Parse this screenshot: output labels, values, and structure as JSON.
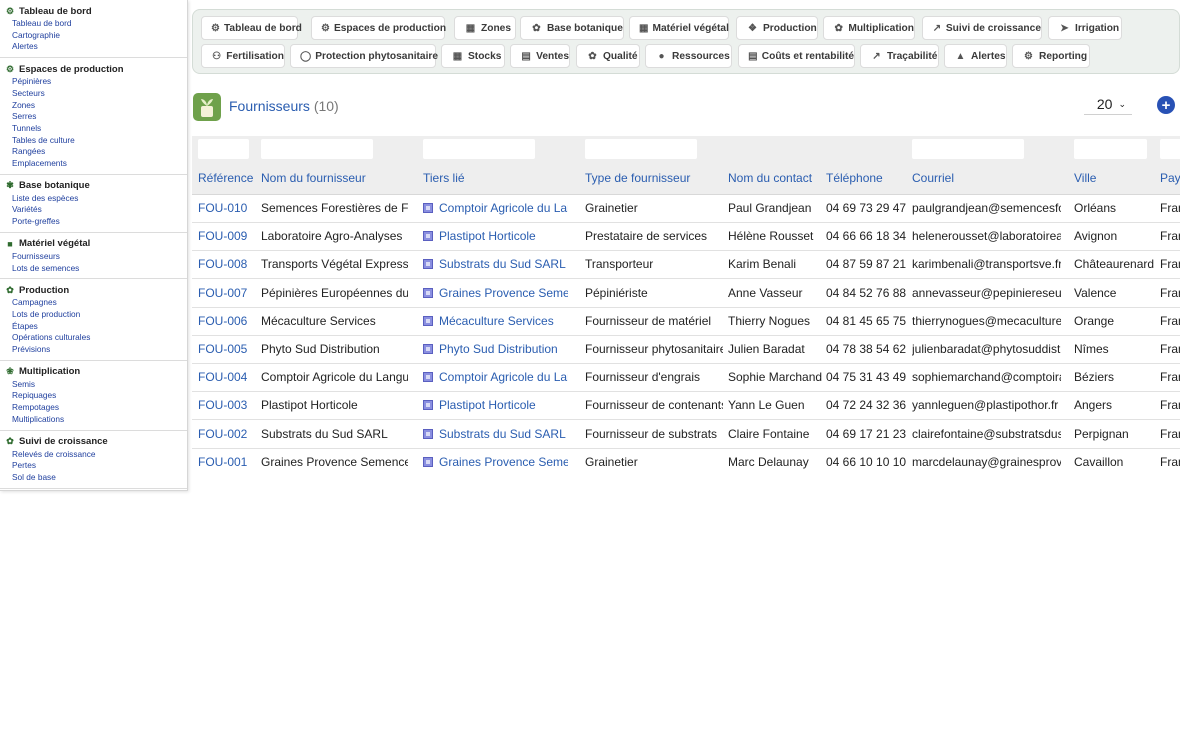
{
  "sidebar": {
    "sections": [
      {
        "title": "Tableau de bord",
        "links": [
          "Tableau de bord",
          "Cartographie",
          "Alertes"
        ]
      },
      {
        "title": "Espaces de production",
        "links": [
          "Pépinières",
          "Secteurs",
          "Zones",
          "Serres",
          "Tunnels",
          "Tables de culture",
          "Rangées",
          "Emplacements"
        ]
      },
      {
        "title": "Base botanique",
        "links": [
          "Liste des espèces",
          "Variétés",
          "Porte-greffes"
        ]
      },
      {
        "title": "Matériel végétal",
        "links": [
          "Fournisseurs",
          "Lots de semences"
        ]
      },
      {
        "title": "Production",
        "links": [
          "Campagnes",
          "Lots de production",
          "Étapes",
          "Opérations culturales",
          "Prévisions"
        ]
      },
      {
        "title": "Multiplication",
        "links": [
          "Semis",
          "Repiquages",
          "Rempotages",
          "Multiplications"
        ]
      },
      {
        "title": "Suivi de croissance",
        "links": [
          "Relevés de croissance",
          "Pertes",
          "Sol de base"
        ]
      }
    ]
  },
  "nav": {
    "row1": [
      "Tableau de bord",
      "Espaces de production",
      "Zones",
      "Base botanique",
      "Matériel végétal",
      "Production",
      "Multiplication",
      "Suivi de croissance",
      "Irrigation"
    ],
    "row2": [
      "Fertilisation",
      "Protection phytosanitaire",
      "Stocks",
      "Ventes",
      "Qualité",
      "Ressources",
      "Coûts et rentabilité",
      "Traçabilité",
      "Alertes",
      "Reporting"
    ]
  },
  "page": {
    "title": "Fournisseurs",
    "count": "(10)",
    "page_size": "20",
    "add_label": "+"
  },
  "table": {
    "columns": [
      "Référence",
      "Nom du fournisseur",
      "Tiers lié",
      "Type de fournisseur",
      "Nom du contact",
      "Téléphone",
      "Courriel",
      "Ville",
      "Pays"
    ],
    "rows": [
      [
        "FOU-010",
        "Semences Forestières de France",
        "Comptoir Agricole du Languedoc",
        "Grainetier",
        "Paul Grandjean",
        "04 69 73 29 47",
        "paulgrandjean@semencesforestieres.fr",
        "Orléans",
        "France"
      ],
      [
        "FOU-009",
        "Laboratoire Agro-Analyses",
        "Plastipot Horticole",
        "Prestataire de services",
        "Hélène Rousset",
        "04 66 66 18 34",
        "helenerousset@laboratoirea.fr",
        "Avignon",
        "France"
      ],
      [
        "FOU-008",
        "Transports Végétal Express",
        "Substrats du Sud SARL",
        "Transporteur",
        "Karim Benali",
        "04 87 59 87 21",
        "karimbenali@transportsve.fr",
        "Châteaurenard",
        "France"
      ],
      [
        "FOU-007",
        "Pépinières Européennes du Sud",
        "Graines Provence Semences",
        "Pépiniériste",
        "Anne Vasseur",
        "04 84 52 76 88",
        "annevasseur@pepiniereseu.fr",
        "Valence",
        "France"
      ],
      [
        "FOU-006",
        "Mécaculture Services",
        "Mécaculture Services",
        "Fournisseur de matériel",
        "Thierry Nogues",
        "04 81 45 65 75",
        "thierrynogues@mecaculture.fr",
        "Orange",
        "France"
      ],
      [
        "FOU-005",
        "Phyto Sud Distribution",
        "Phyto Sud Distribution",
        "Fournisseur phytosanitaire",
        "Julien Baradat",
        "04 78 38 54 62",
        "julienbaradat@phytosuddist.fr",
        "Nîmes",
        "France"
      ],
      [
        "FOU-004",
        "Comptoir Agricole du Languedoc",
        "Comptoir Agricole du Languedoc",
        "Fournisseur d'engrais",
        "Sophie Marchand",
        "04 75 31 43 49",
        "sophiemarchand@comptoiragricole.fr",
        "Béziers",
        "France"
      ],
      [
        "FOU-003",
        "Plastipot Horticole",
        "Plastipot Horticole",
        "Fournisseur de contenants",
        "Yann Le Guen",
        "04 72 24 32 36",
        "yannleguen@plastipothor.fr",
        "Angers",
        "France"
      ],
      [
        "FOU-002",
        "Substrats du Sud SARL",
        "Substrats du Sud SARL",
        "Fournisseur de substrats",
        "Claire Fontaine",
        "04 69 17 21 23",
        "clairefontaine@substratsdus.fr",
        "Perpignan",
        "France"
      ],
      [
        "FOU-001",
        "Graines Provence Semences",
        "Graines Provence Semences",
        "Grainetier",
        "Marc Delaunay",
        "04 66 10 10 10",
        "marcdelaunay@grainesprovence.fr",
        "Cavaillon",
        "France"
      ]
    ]
  },
  "colors": {
    "accent": "#2a5db0",
    "nav_bg": "#edf1ee",
    "logo_green": "#6fa14b",
    "add_button": "#2851b5"
  }
}
